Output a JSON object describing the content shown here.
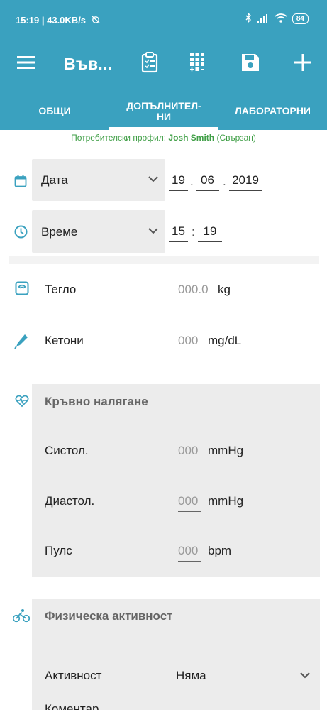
{
  "status": {
    "left": "15:19 | 43.0KB/s",
    "battery": "84"
  },
  "toolbar": {
    "title": "Във..."
  },
  "tabs": [
    {
      "label": "ОБЩИ"
    },
    {
      "label": "ДОПЪЛНИТЕЛ-\nНИ"
    },
    {
      "label": "ЛАБОРАТОРНИ"
    }
  ],
  "profile": {
    "prefix": "Потребителски профил: ",
    "name": "Josh Smith",
    "suffix": " (Свързан)"
  },
  "date": {
    "label": "Дата",
    "day": "19",
    "month": "06",
    "year": "2019",
    "sep": "."
  },
  "time": {
    "label": "Време",
    "hour": "15",
    "minute": "19",
    "sep": ":"
  },
  "weight": {
    "label": "Тегло",
    "placeholder": "000.0",
    "unit": "kg"
  },
  "ketones": {
    "label": "Кетони",
    "placeholder": "000",
    "unit": "mg/dL"
  },
  "blood_pressure": {
    "title": "Кръвно налягане",
    "systolic": {
      "label": "Систол.",
      "placeholder": "000",
      "unit": "mmHg"
    },
    "diastolic": {
      "label": "Диастол.",
      "placeholder": "000",
      "unit": "mmHg"
    },
    "pulse": {
      "label": "Пулс",
      "placeholder": "000",
      "unit": "bpm"
    }
  },
  "activity": {
    "title": "Физическа активност",
    "activity_label": "Активност",
    "activity_value": "Няма",
    "comment_label": "Коментар"
  },
  "colors": {
    "primary": "#3aa1bf",
    "profile_green": "#3e9e45",
    "panel_bg": "#ececec"
  },
  "icons": [
    "menu-icon",
    "clipboard-icon",
    "keypad-icon",
    "save-icon",
    "add-icon",
    "calendar-icon",
    "clock-icon",
    "scale-icon",
    "dropper-icon",
    "heart-pulse-icon",
    "bicycle-icon",
    "chevron-down-icon"
  ]
}
